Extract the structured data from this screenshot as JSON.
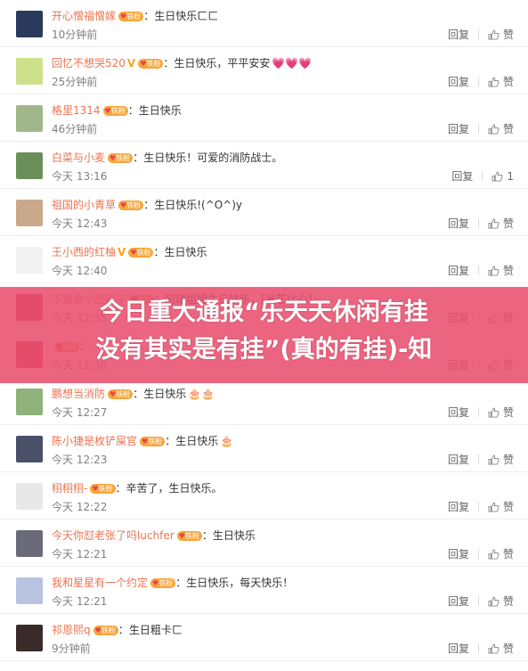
{
  "comments": [
    {
      "user": "开心憎福憎嫁",
      "verified": false,
      "text": "生日快乐ㄈㄈ",
      "time": "10分钟前",
      "reply": "回复",
      "like": "赞",
      "emoji": ""
    },
    {
      "user": "回忆不想哭520",
      "verified": true,
      "text": "生日快乐，平平安安",
      "time": "25分钟前",
      "reply": "回复",
      "like": "赞",
      "emoji": "💗💗💗"
    },
    {
      "user": "格里1314",
      "verified": false,
      "text": "生日快乐",
      "time": "46分钟前",
      "reply": "回复",
      "like": "赞",
      "emoji": ""
    },
    {
      "user": "白菜与小麦",
      "verified": false,
      "text": "生日快乐！可爱的消防战士。",
      "time": "今天 13:16",
      "reply": "回复",
      "like": "1",
      "emoji": ""
    },
    {
      "user": "祖国的小青草",
      "verified": false,
      "text": "生日快乐!(^O^)y",
      "time": "今天 12:43",
      "reply": "回复",
      "like": "赞",
      "emoji": ""
    },
    {
      "user": "王小西的红柚",
      "verified": true,
      "text": "生日快乐",
      "time": "今天 12:40",
      "reply": "回复",
      "like": "赞",
      "emoji": ""
    },
    {
      "user": "不爱余个此孩子",
      "verified": false,
      "text": "阿瑞姐姐生日快乐，[光芒比心]",
      "time": "今天 12:35",
      "reply": "回复",
      "like": "赞",
      "emoji": ""
    },
    {
      "user": "",
      "verified": false,
      "text": "",
      "time": "今天 12:30",
      "reply": "回复",
      "like": "赞",
      "emoji": ""
    },
    {
      "user": "鹏想当消防",
      "verified": false,
      "text": "生日快乐",
      "time": "今天 12:27",
      "reply": "回复",
      "like": "赞",
      "emoji": "🎂🎂"
    },
    {
      "user": "陈小捷是枚铲屎官",
      "verified": false,
      "text": "生日快乐",
      "time": "今天 12:23",
      "reply": "回复",
      "like": "赞",
      "emoji": "🎂"
    },
    {
      "user": "栩栩栩-",
      "verified": false,
      "text": "辛苦了，生日快乐。",
      "time": "今天 12:22",
      "reply": "回复",
      "like": "赞",
      "emoji": ""
    },
    {
      "user": "今天你怼老张了吗luchfer",
      "verified": false,
      "text": "生日快乐",
      "time": "今天 12:21",
      "reply": "回复",
      "like": "赞",
      "emoji": ""
    },
    {
      "user": "我和星星有一个约定",
      "verified": false,
      "text": "生日快乐，每天快乐！",
      "time": "今天 12:21",
      "reply": "回复",
      "like": "赞",
      "emoji": ""
    },
    {
      "user": "祁恩熙q",
      "verified": false,
      "text": "生日粗卡ㄈ",
      "time": "9分钟前",
      "reply": "回复",
      "like": "赞",
      "emoji": ""
    }
  ],
  "fan_badge": "铁粉",
  "v_mark": "V",
  "overlay": {
    "line1": "今日重大通报“乐天天休闲有挂",
    "line2": "没有其实是有挂”(真的有挂)-知"
  },
  "colors": {
    "username": "#eb7350",
    "overlay": "#e84e6e",
    "badge": "#f7a53a"
  }
}
